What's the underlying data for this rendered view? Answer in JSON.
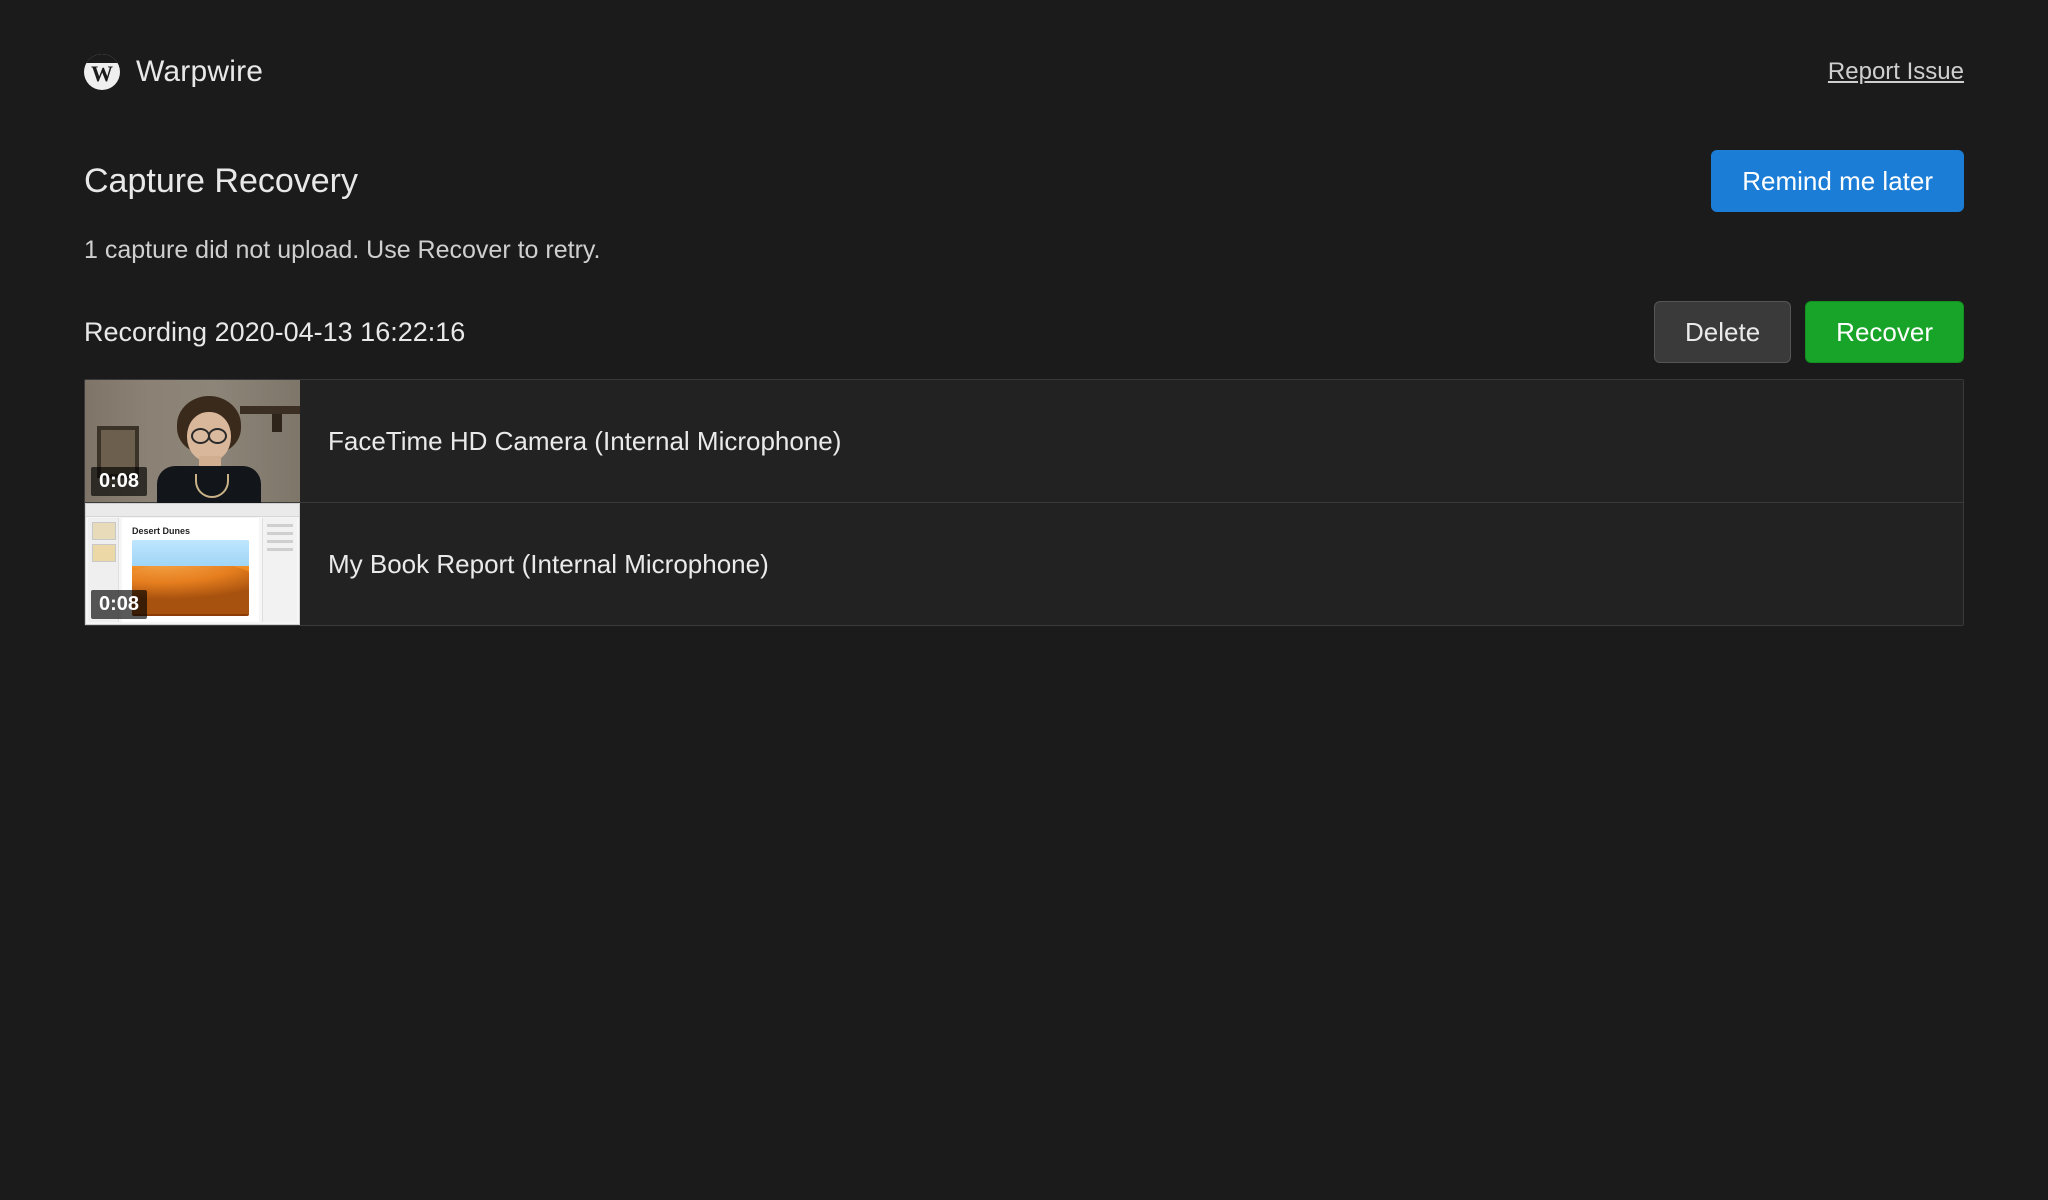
{
  "brand": {
    "name": "Warpwire",
    "logo_letter": "W"
  },
  "header": {
    "report_issue": "Report Issue"
  },
  "page": {
    "title": "Capture Recovery",
    "remind_label": "Remind me later",
    "subtext": "1 capture did not upload. Use Recover to retry."
  },
  "recording": {
    "title": "Recording 2020-04-13 16:22:16",
    "delete_label": "Delete",
    "recover_label": "Recover",
    "sources": [
      {
        "label": "FaceTime HD Camera (Internal Microphone)",
        "duration": "0:08",
        "thumb_kind": "cam"
      },
      {
        "label": "My Book Report (Internal Microphone)",
        "duration": "0:08",
        "thumb_kind": "screen",
        "doc_title": "Desert Dunes"
      }
    ]
  }
}
